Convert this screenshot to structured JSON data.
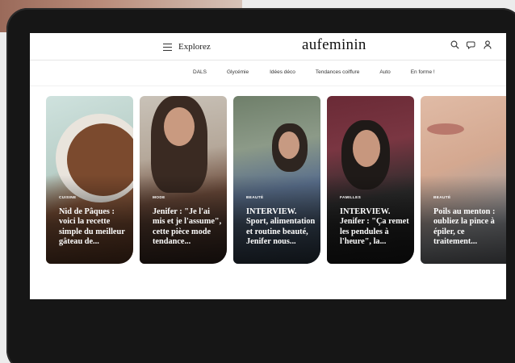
{
  "header": {
    "menu_label": "Explorez",
    "logo": "aufeminin",
    "icons": [
      "search-icon",
      "chat-icon",
      "user-icon"
    ]
  },
  "nav": {
    "items": [
      "DALS",
      "Glycémie",
      "Idées déco",
      "Tendances coiffure",
      "Auto",
      "En forme !"
    ]
  },
  "cards": [
    {
      "category": "CUISINE",
      "title": "Nid de Pâques : voici la recette simple du meilleur gâteau de..."
    },
    {
      "category": "MODE",
      "title": "Jenifer : \"Je l'ai mis et je l'assume\", cette pièce mode tendance..."
    },
    {
      "category": "BEAUTÉ",
      "title": "INTERVIEW. Sport, alimentation et routine beauté, Jenifer nous..."
    },
    {
      "category": "FAMILLES",
      "title": "INTERVIEW. Jenifer : \"Ça remet les pendules à l'heure\", la..."
    },
    {
      "category": "BEAUTÉ",
      "title": "Poils au menton : oubliez la pince à épiler, ce traitement..."
    }
  ]
}
